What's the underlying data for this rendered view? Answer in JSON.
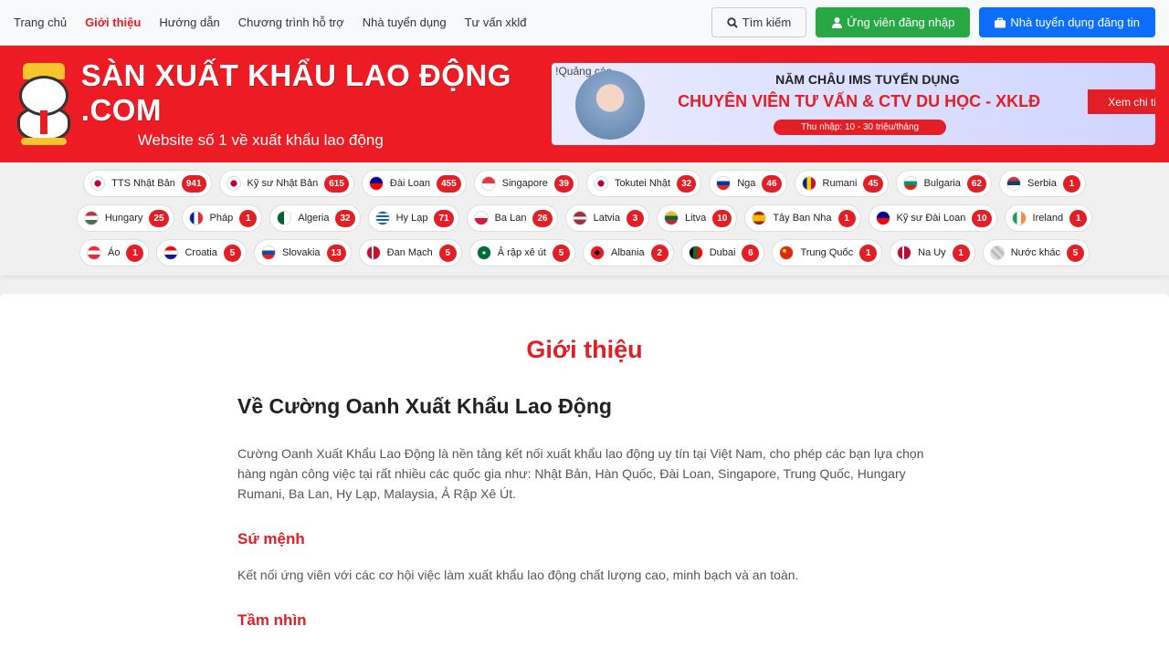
{
  "nav": {
    "links": [
      "Trang chủ",
      "Giới thiệu",
      "Hướng dẫn",
      "Chương trình hỗ trợ",
      "Nhà tuyển dụng",
      "Tư vấn xklđ"
    ],
    "active_index": 1,
    "search_label": "Tìm kiếm",
    "candidate_login_label": "Ứng viên đăng nhập",
    "employer_post_label": "Nhà tuyển dụng đăng tin"
  },
  "banner": {
    "logo_title": "SÀN XUẤT KHẨU LAO ĐỘNG .COM",
    "logo_subtitle": "Website số 1 về xuất khẩu lao động",
    "ad_tag": "!Quảng cáo",
    "ad_line1": "NĂM CHÂU IMS TUYỂN DỤNG",
    "ad_line2": "CHUYÊN VIÊN TƯ VẤN & CTV DU HỌC - XKLĐ",
    "ad_line3": "Thu nhập: 10 - 30 triệu/tháng",
    "ad_cta": "Xem chi tiết"
  },
  "countries": [
    [
      {
        "name": "TTS Nhật Bản",
        "count": "941",
        "flag": "jp"
      },
      {
        "name": "Kỹ sư Nhật Bản",
        "count": "615",
        "flag": "jp"
      },
      {
        "name": "Đài Loan",
        "count": "455",
        "flag": "tw"
      },
      {
        "name": "Singapore",
        "count": "39",
        "flag": "sg"
      },
      {
        "name": "Tokutei Nhật",
        "count": "32",
        "flag": "jp"
      },
      {
        "name": "Nga",
        "count": "46",
        "flag": "ru"
      },
      {
        "name": "Rumani",
        "count": "45",
        "flag": "ro"
      },
      {
        "name": "Bulgaria",
        "count": "62",
        "flag": "bg"
      },
      {
        "name": "Serbia",
        "count": "1",
        "flag": "rs"
      }
    ],
    [
      {
        "name": "Hungary",
        "count": "25",
        "flag": "hu"
      },
      {
        "name": "Pháp",
        "count": "1",
        "flag": "fr"
      },
      {
        "name": "Algeria",
        "count": "32",
        "flag": "dz"
      },
      {
        "name": "Hy Lạp",
        "count": "71",
        "flag": "gr"
      },
      {
        "name": "Ba Lan",
        "count": "26",
        "flag": "pl"
      },
      {
        "name": "Latvia",
        "count": "3",
        "flag": "lv"
      },
      {
        "name": "Litva",
        "count": "10",
        "flag": "lt"
      },
      {
        "name": "Tây Ban Nha",
        "count": "1",
        "flag": "es"
      },
      {
        "name": "Kỹ sư Đài Loan",
        "count": "10",
        "flag": "tw"
      },
      {
        "name": "Ireland",
        "count": "1",
        "flag": "ie"
      }
    ],
    [
      {
        "name": "Áo",
        "count": "1",
        "flag": "at"
      },
      {
        "name": "Croatia",
        "count": "5",
        "flag": "hr"
      },
      {
        "name": "Slovakia",
        "count": "13",
        "flag": "sk"
      },
      {
        "name": "Đan Mạch",
        "count": "5",
        "flag": "dk"
      },
      {
        "name": "Ả rập xê út",
        "count": "5",
        "flag": "sa"
      },
      {
        "name": "Albania",
        "count": "2",
        "flag": "al"
      },
      {
        "name": "Dubai",
        "count": "6",
        "flag": "ae"
      },
      {
        "name": "Trung Quốc",
        "count": "1",
        "flag": "cn"
      },
      {
        "name": "Na Uy",
        "count": "1",
        "flag": "no"
      },
      {
        "name": "Nước khác",
        "count": "5",
        "flag": "other"
      }
    ]
  ],
  "flag_styles": {
    "jp": "radial-gradient(circle,#bc002d 35%,#fff 36%)",
    "tw": "linear-gradient(180deg,#000095 50%,#fe0000 50%)",
    "sg": "linear-gradient(180deg,#ef3340 50%,#fff 50%)",
    "ru": "linear-gradient(180deg,#fff 33%,#0039a6 33%,#0039a6 66%,#d52b1e 66%)",
    "ro": "linear-gradient(90deg,#002b7f 33%,#fcd116 33%,#fcd116 66%,#ce1126 66%)",
    "bg": "linear-gradient(180deg,#fff 33%,#00966e 33%,#00966e 66%,#d62612 66%)",
    "rs": "linear-gradient(180deg,#c6363c 33%,#0c4076 33%,#0c4076 66%,#fff 66%)",
    "hu": "linear-gradient(180deg,#cd2a3e 33%,#fff 33%,#fff 66%,#436f4d 66%)",
    "fr": "linear-gradient(90deg,#002395 33%,#fff 33%,#fff 66%,#ed2939 66%)",
    "dz": "linear-gradient(90deg,#006233 50%,#fff 50%)",
    "gr": "repeating-linear-gradient(180deg,#0d5eaf 0 2px,#fff 2px 4px)",
    "pl": "linear-gradient(180deg,#fff 50%,#dc143c 50%)",
    "lv": "linear-gradient(180deg,#9e3039 40%,#fff 40%,#fff 60%,#9e3039 60%)",
    "lt": "linear-gradient(180deg,#fdb913 33%,#006a44 33%,#006a44 66%,#c1272d 66%)",
    "es": "linear-gradient(180deg,#aa151b 25%,#f1bf00 25%,#f1bf00 75%,#aa151b 75%)",
    "ie": "linear-gradient(90deg,#169b62 33%,#fff 33%,#fff 66%,#ff883e 66%)",
    "at": "linear-gradient(180deg,#ed2939 33%,#fff 33%,#fff 66%,#ed2939 66%)",
    "hr": "linear-gradient(180deg,#ff0000 33%,#fff 33%,#fff 66%,#171796 66%)",
    "sk": "linear-gradient(180deg,#fff 33%,#0b4ea2 33%,#0b4ea2 66%,#ee1c25 66%)",
    "dk": "linear-gradient(90deg,#c8102e 35%,#fff 35%,#fff 50%,#c8102e 50%)",
    "sa": "radial-gradient(circle,#fff 15%,#006c35 16%)",
    "al": "radial-gradient(circle,#000 25%,#e41e20 26%)",
    "ae": "linear-gradient(90deg,#000 30%,#00732f 30%,#00732f 60%,#ff0000 60%)",
    "cn": "radial-gradient(circle at 35% 35%,#ffde00 15%,#de2910 16%)",
    "no": "linear-gradient(90deg,#ba0c2f 35%,#fff 35%,#fff 50%,#ba0c2f 50%)",
    "other": "repeating-linear-gradient(45deg,#bbb 0 3px,#ddd 3px 6px)"
  },
  "page": {
    "title": "Giới thiệu",
    "heading": "Về Cường Oanh Xuất Khẩu Lao Động",
    "intro": "Cường Oanh Xuất Khẩu Lao Động là nền tảng kết nối xuất khẩu lao động uy tín tại Việt Nam, cho phép các bạn lựa chọn hàng ngàn công việc tại rất nhiều các quốc gia như: Nhật Bản, Hàn Quốc, Đài Loan, Singapore, Trung Quốc, Hungary Rumani, Ba Lan, Hy Lạp, Malaysia, Ả Rập Xê Út.",
    "mission_title": "Sứ mệnh",
    "mission_text": "Kết nối ứng viên với các cơ hội việc làm xuất khẩu lao động chất lượng cao, minh bạch và an toàn.",
    "vision_title": "Tầm nhìn"
  }
}
